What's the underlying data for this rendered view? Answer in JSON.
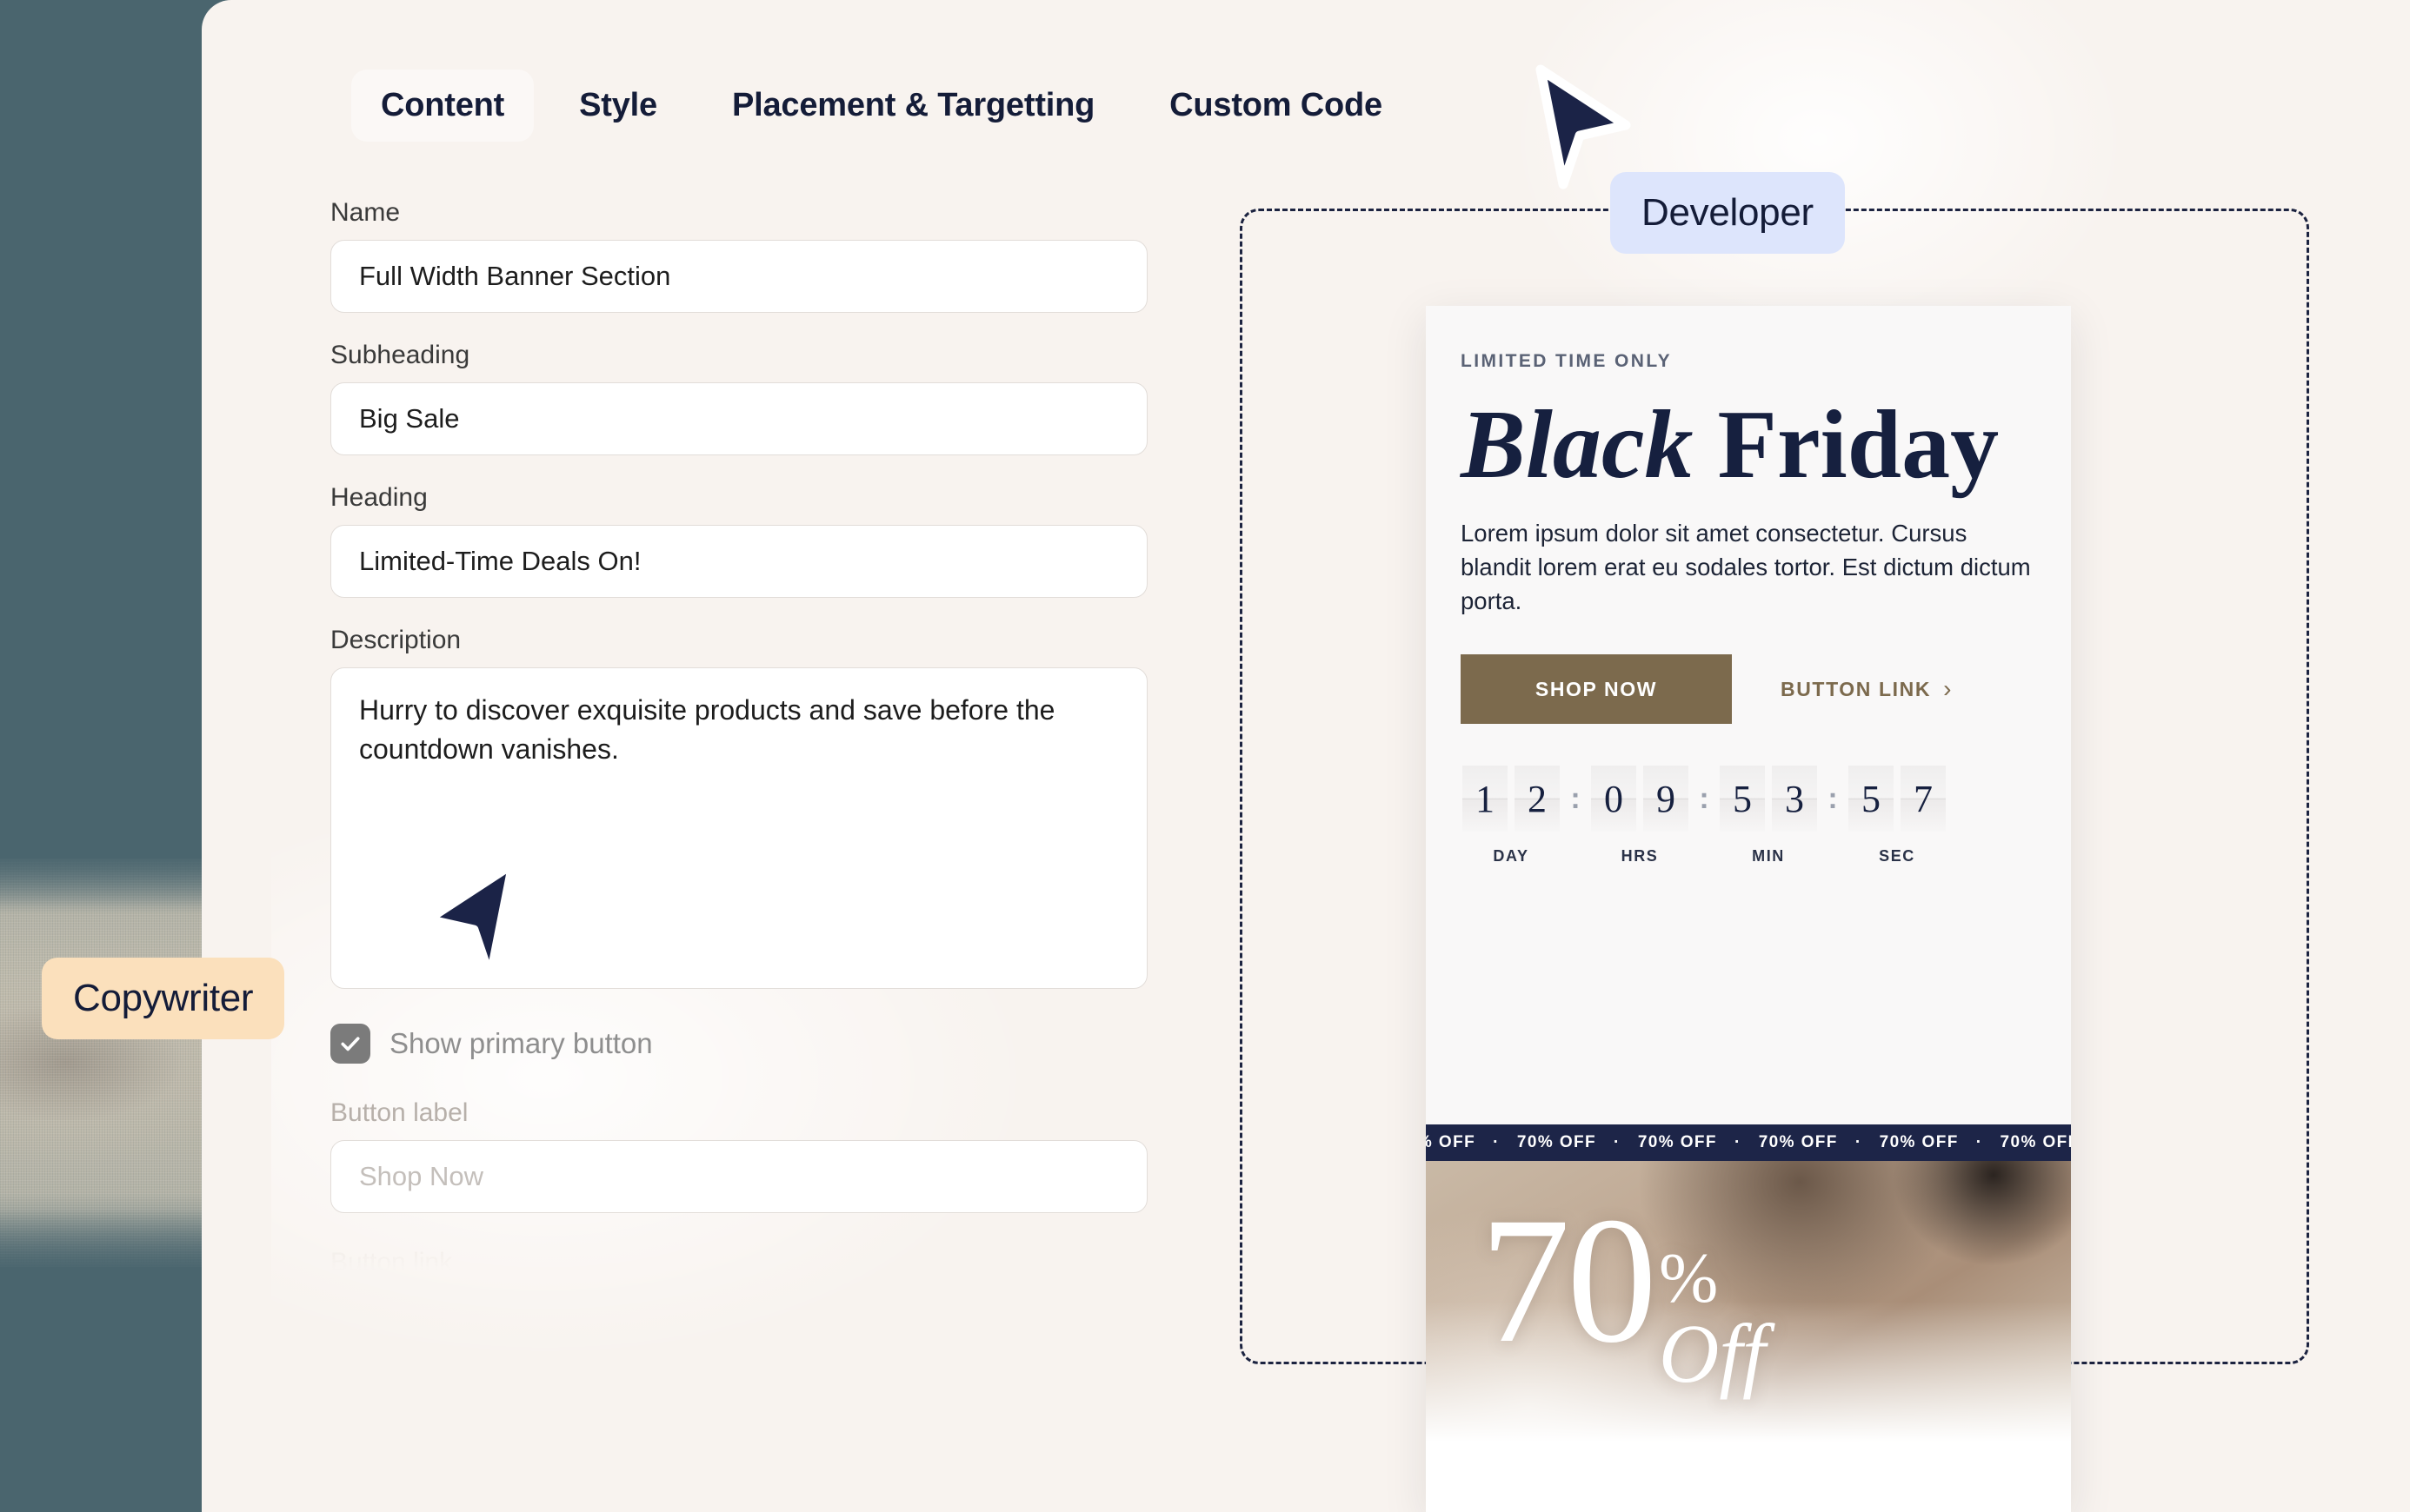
{
  "background": {
    "teal_color": "#4a656e",
    "card_color": "#f8f3ef"
  },
  "tabs": [
    {
      "label": "Content",
      "active": true
    },
    {
      "label": "Style",
      "active": false
    },
    {
      "label": "Placement & Targetting",
      "active": false
    },
    {
      "label": "Custom Code",
      "active": false
    }
  ],
  "form": {
    "name": {
      "label": "Name",
      "value": "Full Width Banner Section",
      "placeholder": "Name"
    },
    "subheading": {
      "label": "Subheading",
      "value": "Big Sale",
      "placeholder": "Subheading"
    },
    "heading": {
      "label": "Heading",
      "value": "Limited-Time Deals On!",
      "placeholder": "Heading"
    },
    "description": {
      "label": "Description",
      "value": "Hurry to discover exquisite products and save before the countdown vanishes.",
      "placeholder": "Description"
    },
    "show_primary_button": {
      "label": "Show primary button",
      "checked": true
    },
    "button_label": {
      "label": "Button label",
      "value": "",
      "placeholder": "Shop Now"
    },
    "button_link": {
      "label": "Button link"
    }
  },
  "badges": {
    "developer": {
      "label": "Developer",
      "color": "#dde5fc"
    },
    "copywriter": {
      "label": "Copywriter",
      "color": "#fbe0bc"
    }
  },
  "preview": {
    "eyebrow": "LIMITED TIME ONLY",
    "title_italic": "Black",
    "title_regular": "Friday",
    "description": "Lorem ipsum dolor sit amet consectetur. Cursus blandit lorem erat eu sodales tortor. Est dictum dictum porta.",
    "primary_button": {
      "label": "SHOP NOW",
      "color": "#7c6a4d"
    },
    "secondary_link": {
      "label": "BUTTON LINK",
      "chevron": "›",
      "color": "#7c6a4d"
    },
    "countdown": {
      "separator": ":",
      "groups": [
        {
          "label": "DAY",
          "digits": [
            "1",
            "2"
          ]
        },
        {
          "label": "HRS",
          "digits": [
            "0",
            "9"
          ]
        },
        {
          "label": "MIN",
          "digits": [
            "5",
            "3"
          ]
        },
        {
          "label": "SEC",
          "digits": [
            "5",
            "7"
          ]
        }
      ]
    },
    "marquee": {
      "text": "70% OFF",
      "separator": "·",
      "background": "#1d2548"
    },
    "hero": {
      "number": "70",
      "percent": "%",
      "off": "Off"
    }
  }
}
